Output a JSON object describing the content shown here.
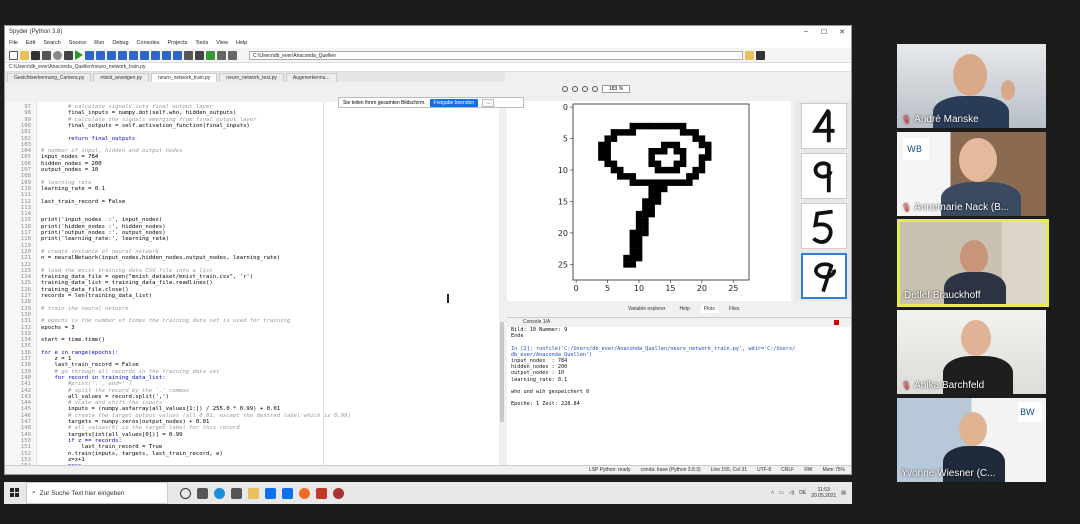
{
  "spyder": {
    "window_title": "Spyder (Python 3.8)",
    "menu": [
      "File",
      "Edit",
      "Search",
      "Source",
      "Run",
      "Debug",
      "Consoles",
      "Projects",
      "Tools",
      "View",
      "Help"
    ],
    "working_dir": "C:\\Users\\db_ever\\Anaconda_Quellen",
    "file_path": "C:\\Users\\db_ever\\Anaconda_Quellen\\neuro_network_train.py",
    "tabs": [
      "Gesichtserkennung_Camera.py",
      "mnist_anzeigen.py",
      "neuro_network_train.py",
      "neuro_network_test.py",
      "Augenerkennu..."
    ],
    "active_tab_index": 2,
    "code_lines": [
      {
        "n": "97",
        "t": "        # calculate signals into final output layer",
        "k": "comment"
      },
      {
        "n": "98",
        "t": "        final_inputs = numpy.dot(self.who, hidden_outputs)",
        "k": "code"
      },
      {
        "n": "99",
        "t": "        # calculate the signals emerging from final output layer",
        "k": "comment"
      },
      {
        "n": "100",
        "t": "        final_outputs = self.activation_function(final_inputs)",
        "k": "code"
      },
      {
        "n": "101",
        "t": "",
        "k": "code"
      },
      {
        "n": "102",
        "t": "        return final_outputs",
        "k": "kw"
      },
      {
        "n": "103",
        "t": "",
        "k": "code"
      },
      {
        "n": "104",
        "t": "# number of input, hidden and output nodes",
        "k": "comment"
      },
      {
        "n": "105",
        "t": "input_nodes = 784",
        "k": "code"
      },
      {
        "n": "106",
        "t": "hidden_nodes = 200",
        "k": "code"
      },
      {
        "n": "107",
        "t": "output_nodes = 10",
        "k": "code"
      },
      {
        "n": "108",
        "t": "",
        "k": "code"
      },
      {
        "n": "109",
        "t": "# learning rate",
        "k": "comment"
      },
      {
        "n": "110",
        "t": "learning_rate = 0.1",
        "k": "code"
      },
      {
        "n": "111",
        "t": "",
        "k": "code"
      },
      {
        "n": "112",
        "t": "last_train_record = False",
        "k": "code"
      },
      {
        "n": "113",
        "t": "",
        "k": "code"
      },
      {
        "n": "114",
        "t": "",
        "k": "code"
      },
      {
        "n": "115",
        "t": "print('input_nodes  :', input_nodes)",
        "k": "code"
      },
      {
        "n": "116",
        "t": "print('hidden_nodes :', hidden_nodes)",
        "k": "code"
      },
      {
        "n": "117",
        "t": "print('output_nodes :', output_nodes)",
        "k": "code"
      },
      {
        "n": "118",
        "t": "print('learning_rate:', learning_rate)",
        "k": "code"
      },
      {
        "n": "119",
        "t": "",
        "k": "code"
      },
      {
        "n": "120",
        "t": "# create instance of neural network",
        "k": "comment"
      },
      {
        "n": "121",
        "t": "n = neuralNetwork(input_nodes,hidden_nodes,output_nodes, learning_rate)",
        "k": "code"
      },
      {
        "n": "122",
        "t": "",
        "k": "code"
      },
      {
        "n": "123",
        "t": "# load the mnist training data CSV file into a list",
        "k": "comment"
      },
      {
        "n": "124",
        "t": "training_data_file = open(\"mnist_dataset/mnist_train.csv\", 'r')",
        "k": "code"
      },
      {
        "n": "125",
        "t": "training_data_list = training_data_file.readlines()",
        "k": "code"
      },
      {
        "n": "126",
        "t": "training_data_file.close()",
        "k": "code"
      },
      {
        "n": "127",
        "t": "records = len(training_data_list)",
        "k": "code"
      },
      {
        "n": "128",
        "t": "",
        "k": "code"
      },
      {
        "n": "129",
        "t": "# train the neural network",
        "k": "comment"
      },
      {
        "n": "130",
        "t": "",
        "k": "code"
      },
      {
        "n": "131",
        "t": "# epochs is the number of times the training data set is used for training",
        "k": "comment"
      },
      {
        "n": "132",
        "t": "epochs = 3",
        "k": "code"
      },
      {
        "n": "133",
        "t": "",
        "k": "code"
      },
      {
        "n": "134",
        "t": "start = time.time()",
        "k": "code"
      },
      {
        "n": "135",
        "t": "",
        "k": "code"
      },
      {
        "n": "136",
        "t": "for e in range(epochs):",
        "k": "kw"
      },
      {
        "n": "137",
        "t": "    z = 1",
        "k": "code"
      },
      {
        "n": "138",
        "t": "    last_train_record = False",
        "k": "code"
      },
      {
        "n": "139",
        "t": "    # go through all records in the training data set",
        "k": "comment"
      },
      {
        "n": "140",
        "t": "    for record in training_data_list:",
        "k": "kw"
      },
      {
        "n": "141",
        "t": "        #print('.', end='')",
        "k": "comment"
      },
      {
        "n": "142",
        "t": "        # split the record by the ',' commas",
        "k": "comment"
      },
      {
        "n": "143",
        "t": "        all_values = record.split(',')",
        "k": "code"
      },
      {
        "n": "144",
        "t": "        # scale and shift the inputs",
        "k": "comment"
      },
      {
        "n": "145",
        "t": "        inputs = (numpy.asfarray(all_values[1:]) / 255.0 * 0.99) + 0.01",
        "k": "code"
      },
      {
        "n": "146",
        "t": "        # create the target output values (all 0.01, except the desired label which is 0.99)",
        "k": "comment"
      },
      {
        "n": "147",
        "t": "        targets = numpy.zeros(output_nodes) + 0.01",
        "k": "code"
      },
      {
        "n": "148",
        "t": "        # all_values[0] is the target label for this record",
        "k": "comment"
      },
      {
        "n": "149",
        "t": "        targets[int(all_values[0])] = 0.99",
        "k": "code"
      },
      {
        "n": "150",
        "t": "        if z == records:",
        "k": "kw"
      },
      {
        "n": "151",
        "t": "            last_train_record = True",
        "k": "code"
      },
      {
        "n": "152",
        "t": "        n.train(inputs, targets, last_train_record, e)",
        "k": "code"
      },
      {
        "n": "153",
        "t": "        z=z+1",
        "k": "code"
      },
      {
        "n": "154",
        "t": "        pass",
        "k": "kw"
      },
      {
        "n": "155",
        "t": "    diff = time.time() - start",
        "k": "code"
      }
    ],
    "share_banner": {
      "text": "Sie teilen Ihren gesamten Bildschirm.",
      "stop_label": "Freigabe beenden",
      "more_label": "..."
    },
    "plot_zoom": "183 %",
    "pane_tabs": [
      "Variable explorer",
      "Help",
      "Plots",
      "Files"
    ],
    "console_tab": "Console 1/A",
    "console_lines": [
      {
        "t": "Bild: 10 Nummer: 9",
        "k": "plain"
      },
      {
        "t": "Ende",
        "k": "plain"
      },
      {
        "t": "",
        "k": "plain"
      },
      {
        "t": "In [2]: runfile('C:/Users/db_ever/Anaconda_Quellen/neuro_network_train.py', wdir='C:/Users/",
        "k": "blue"
      },
      {
        "t": "db_ever/Anaconda_Quellen')",
        "k": "blue"
      },
      {
        "t": "input_nodes  : 784",
        "k": "plain"
      },
      {
        "t": "hidden_nodes : 200",
        "k": "plain"
      },
      {
        "t": "output_nodes : 10",
        "k": "plain"
      },
      {
        "t": "learning_rate: 0.1",
        "k": "plain"
      },
      {
        "t": "",
        "k": "plain"
      },
      {
        "t": "who und wih gespeichert 0",
        "k": "plain"
      },
      {
        "t": "",
        "k": "plain"
      },
      {
        "t": "Epoche: 1 Zeit: 228.84",
        "k": "plain"
      }
    ],
    "status": [
      "LSP Python: ready",
      "conda: base (Python 3.8.3)",
      "Line 155, Col 31",
      "UTF-8",
      "CRLF",
      "RW",
      "Mem 75%"
    ]
  },
  "chart_data": {
    "type": "heatmap",
    "title": "",
    "x_ticks": [
      "0",
      "5",
      "10",
      "15",
      "20",
      "25"
    ],
    "y_ticks": [
      "0",
      "5",
      "10",
      "15",
      "20",
      "25"
    ],
    "xlim": [
      -0.5,
      27.5
    ],
    "ylim": [
      27.5,
      -0.5
    ],
    "colormap": "gray_r"
  },
  "taskbar": {
    "search_placeholder": "Zur Suche Text hier eingeben",
    "time": "11:53",
    "date": "20.05.2021"
  },
  "participants": [
    {
      "name": "André Manske",
      "muted": true,
      "speaking": false
    },
    {
      "name": "Annemarie Nack (B...",
      "muted": true,
      "speaking": false
    },
    {
      "name": "Detlef Brauckhoff",
      "muted": false,
      "speaking": true
    },
    {
      "name": "Anika Barchfeld",
      "muted": true,
      "speaking": false
    },
    {
      "name": "Yvonne Wiesner (C...",
      "muted": false,
      "speaking": false
    }
  ],
  "colors": {
    "accent": "#0e71eb",
    "speaker_border": "#e7ec4c",
    "mute_red": "#ff4040"
  }
}
